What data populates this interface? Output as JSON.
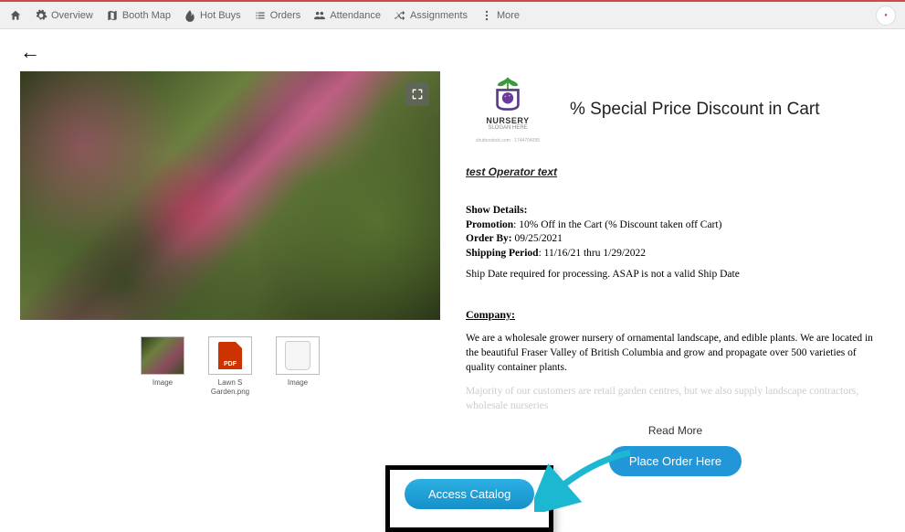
{
  "nav": {
    "items": [
      {
        "label": "Overview",
        "icon": "gear"
      },
      {
        "label": "Booth Map",
        "icon": "map"
      },
      {
        "label": "Hot Buys",
        "icon": "fire"
      },
      {
        "label": "Orders",
        "icon": "list"
      },
      {
        "label": "Attendance",
        "icon": "people"
      },
      {
        "label": "Assignments",
        "icon": "shuffle"
      },
      {
        "label": "More",
        "icon": "dots"
      }
    ]
  },
  "brand": {
    "title": "NURSERY",
    "slogan": "SLOGAN HERE",
    "attrib": "shutterstock.com · 1744704095"
  },
  "headline": "% Special Price Discount in Cart",
  "operator_text": "test Operator text",
  "details": {
    "header": "Show Details:",
    "promotion_label": "Promotion",
    "promotion_value": ": 10% Off in the Cart (% Discount taken off Cart)",
    "orderby_label": "Order By:",
    "orderby_value": " 09/25/2021",
    "shipping_label": "Shipping Period",
    "shipping_value": ": 11/16/21 thru 1/29/2022",
    "note": "Ship Date required for processing. ASAP is not a valid Ship Date"
  },
  "company": {
    "header": "Company:",
    "p1": "We are a wholesale grower nursery of ornamental landscape, and edible plants. We are located in the beautiful Fraser Valley of British Columbia and grow and propagate over 500 varieties of quality container plants.",
    "p2": "Majority of our customers are retail garden centres, but we also supply landscape contractors, wholesale nurseries"
  },
  "actions": {
    "read_more": "Read More",
    "place_order": "Place Order Here",
    "access_catalog": "Access Catalog"
  },
  "thumbs": [
    {
      "label": "Image"
    },
    {
      "label": "Lawn S Garden.png"
    },
    {
      "label": "Image"
    }
  ]
}
